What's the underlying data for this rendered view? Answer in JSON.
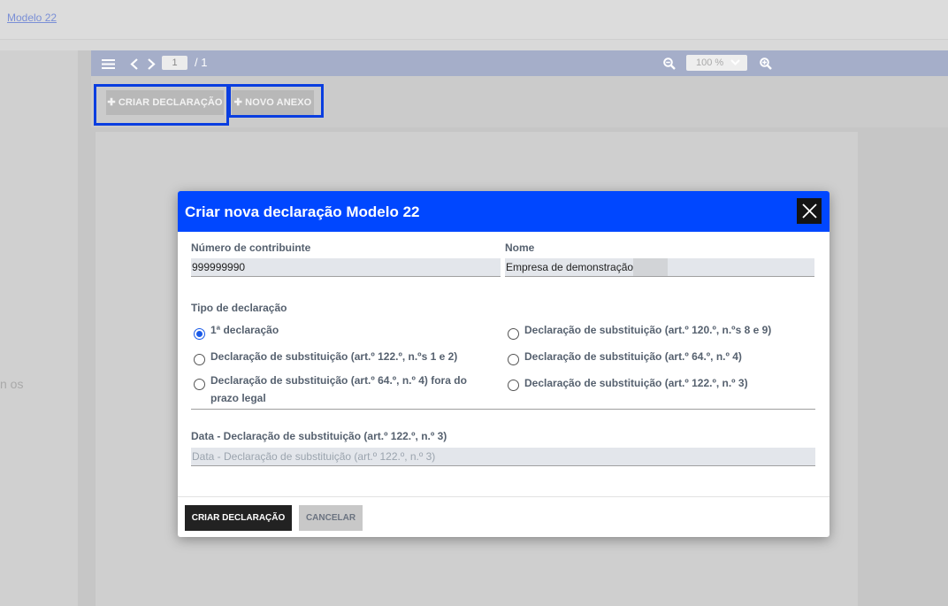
{
  "breadcrumb": {
    "link": "Modelo 22"
  },
  "left_panel": {
    "cut_text": "n os"
  },
  "viewer_toolbar": {
    "menu_icon": "menu-icon",
    "page_current": "1",
    "page_total": "/ 1",
    "zoom_value": "100 %"
  },
  "actions": {
    "create_label": "✚ CRIAR DECLARAÇÃO",
    "annex_label": "✚ NOVO ANEXO"
  },
  "modal": {
    "title": "Criar nova declaração Modelo 22",
    "nif_label": "Número de contribuinte",
    "nif_value": "999999990",
    "name_label": "Nome",
    "name_value": "Empresa de demonstração",
    "type_label": "Tipo de declaração",
    "options_left": [
      {
        "label": "1ª declaração",
        "checked": true
      },
      {
        "label": "Declaração de substituição (art.º 122.º, n.ºs 1 e 2)",
        "checked": false
      },
      {
        "label": "Declaração de substituição (art.º 64.º, n.º 4) fora do prazo legal",
        "checked": false
      }
    ],
    "options_right": [
      {
        "label": "Declaração de substituição (art.º 120.º, n.ºs 8 e 9)",
        "checked": false
      },
      {
        "label": "Declaração de substituição (art.º 64.º, n.º 4)",
        "checked": false
      },
      {
        "label": "Declaração de substituição (art.º 122.º, n.º 3)",
        "checked": false
      }
    ],
    "date_label": "Data - Declaração de substituição (art.º 122.º, n.º 3)",
    "date_placeholder": "Data - Declaração de substituição (art.º 122.º, n.º 3)",
    "create_button": "CRIAR DECLARAÇÃO",
    "cancel_button": "CANCELAR"
  },
  "colors": {
    "modal_header": "#0047ff",
    "highlight_border": "#0a3ee0",
    "toolbar": "#a5aec9",
    "primary_button": "#222222"
  }
}
